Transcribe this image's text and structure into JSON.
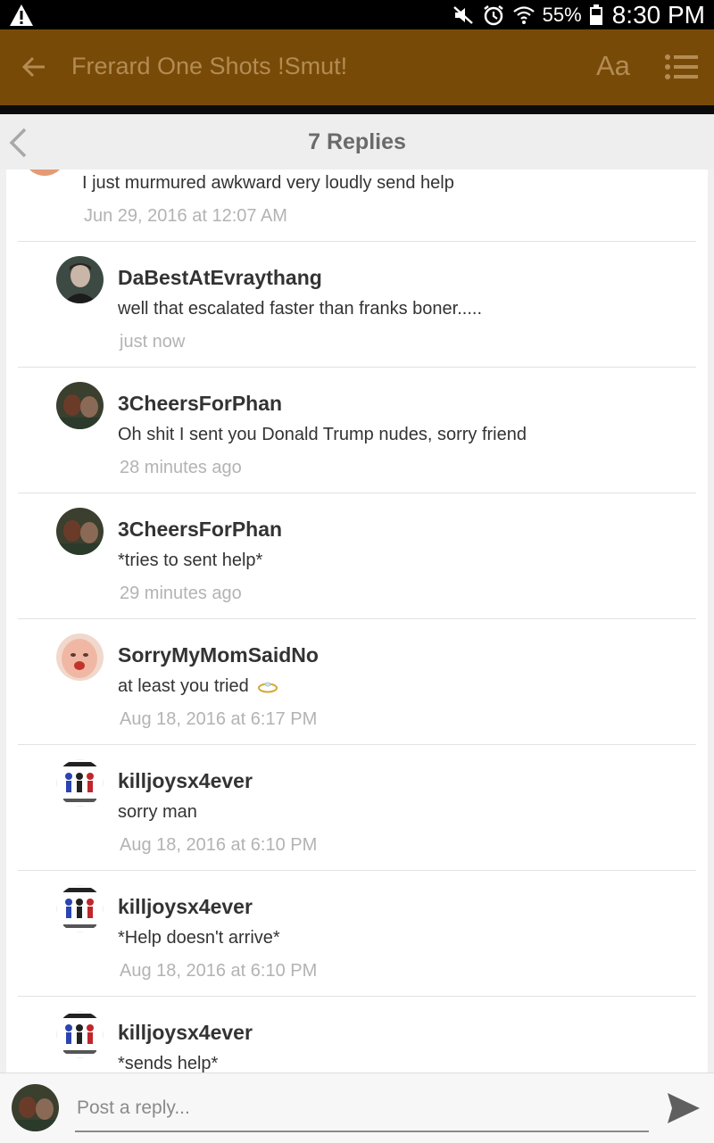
{
  "status_bar": {
    "battery": "55%",
    "time": "8:30 PM"
  },
  "app_bar": {
    "title": "Frerard One Shots !Smut!",
    "font_button": "Aa"
  },
  "thread": {
    "replies_count": "7 Replies"
  },
  "first_comment": {
    "text": "I just murmured awkward very loudly send help",
    "time": "Jun 29, 2016 at 12:07 AM"
  },
  "replies": [
    {
      "name": "DaBestAtEvraythang",
      "text": "well that escalated faster than franks boner.....",
      "time": "just now",
      "avatar": "person-photo"
    },
    {
      "name": "3CheersForPhan",
      "text": "Oh shit I sent you Donald Trump nudes, sorry friend",
      "time": "28 minutes ago",
      "avatar": "person-photo"
    },
    {
      "name": "3CheersForPhan",
      "text": "*tries to sent help*",
      "time": "29 minutes ago",
      "avatar": "person-photo"
    },
    {
      "name": "SorryMyMomSaidNo",
      "text": "at least you tried",
      "time": "Aug 18, 2016 at 6:17 PM",
      "avatar": "baby-face"
    },
    {
      "name": "killjoysx4ever",
      "text": "sorry man",
      "time": "Aug 18, 2016 at 6:10 PM",
      "avatar": "cartoon-figures"
    },
    {
      "name": "killjoysx4ever",
      "text": "*Help doesn't arrive*",
      "time": "Aug 18, 2016 at 6:10 PM",
      "avatar": "cartoon-figures"
    },
    {
      "name": "killjoysx4ever",
      "text": "*sends help*",
      "time": "",
      "avatar": "cartoon-figures"
    }
  ],
  "composer": {
    "placeholder": "Post a reply..."
  },
  "colors": {
    "app_bar": "#784a08",
    "app_bar_text": "#b38c53"
  }
}
